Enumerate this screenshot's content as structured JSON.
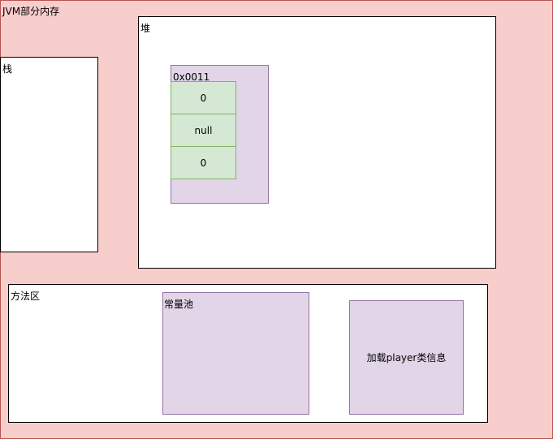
{
  "diagram": {
    "title": "JVM部分内存",
    "stack": {
      "label": "栈"
    },
    "heap": {
      "label": "堆",
      "object": {
        "address": "0x0011",
        "fields": [
          "0",
          "null",
          "0"
        ]
      }
    },
    "method_area": {
      "label": "方法区",
      "constant_pool": {
        "label": "常量池"
      },
      "class_info": {
        "label": "加载player类信息"
      }
    }
  },
  "colors": {
    "outer_fill": "#f8cecc",
    "outer_stroke": "#b85450",
    "purple_fill": "#e1d5e7",
    "purple_stroke": "#9673a6",
    "green_fill": "#d5e8d4",
    "green_stroke": "#82b366"
  }
}
